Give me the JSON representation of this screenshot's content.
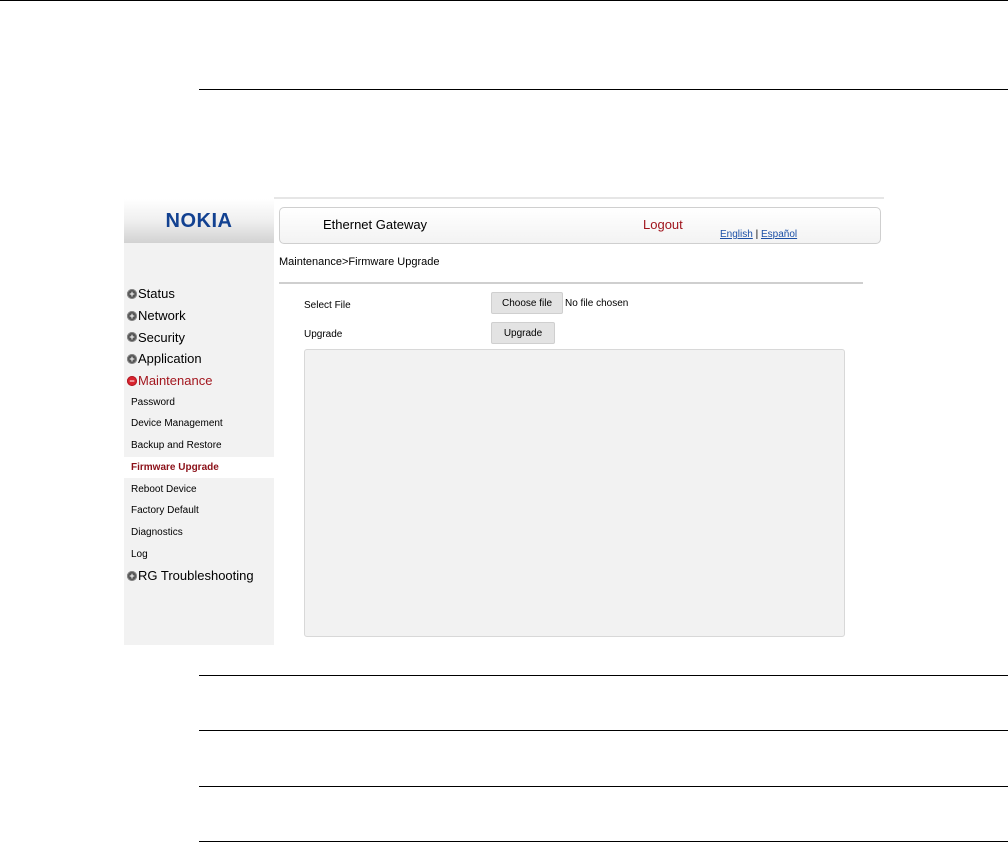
{
  "brand": {
    "logo_text": "NOKIA",
    "color": "#124191"
  },
  "header": {
    "device_title": "Ethernet Gateway",
    "logout_label": "Logout",
    "lang_english": "English",
    "lang_separator": "|",
    "lang_spanish": "Español"
  },
  "breadcrumb": "Maintenance>Firmware Upgrade",
  "sidebar": {
    "groups_top": [
      {
        "label": "Status",
        "marker": "+"
      },
      {
        "label": "Network",
        "marker": "+"
      },
      {
        "label": "Security",
        "marker": "+"
      },
      {
        "label": "Application",
        "marker": "+"
      }
    ],
    "active_group": {
      "label": "Maintenance",
      "marker": "−"
    },
    "sub_items": [
      {
        "label": "Password"
      },
      {
        "label": "Device Management"
      },
      {
        "label": "Backup and Restore"
      },
      {
        "label": "Firmware Upgrade",
        "selected": true
      },
      {
        "label": "Reboot Device"
      },
      {
        "label": "Factory Default"
      },
      {
        "label": "Diagnostics"
      },
      {
        "label": "Log"
      }
    ],
    "groups_bottom": [
      {
        "label": "RG Troubleshooting",
        "marker": "+"
      }
    ]
  },
  "form": {
    "select_file_label": "Select File",
    "choose_file_label": "Choose file",
    "file_status": "No file chosen",
    "upgrade_label": "Upgrade",
    "upgrade_button": "Upgrade",
    "status_log": ""
  },
  "colors": {
    "accent_red": "#a3171f",
    "link_blue": "#1a4fa6",
    "sidebar_bg": "#f2f2f2"
  }
}
